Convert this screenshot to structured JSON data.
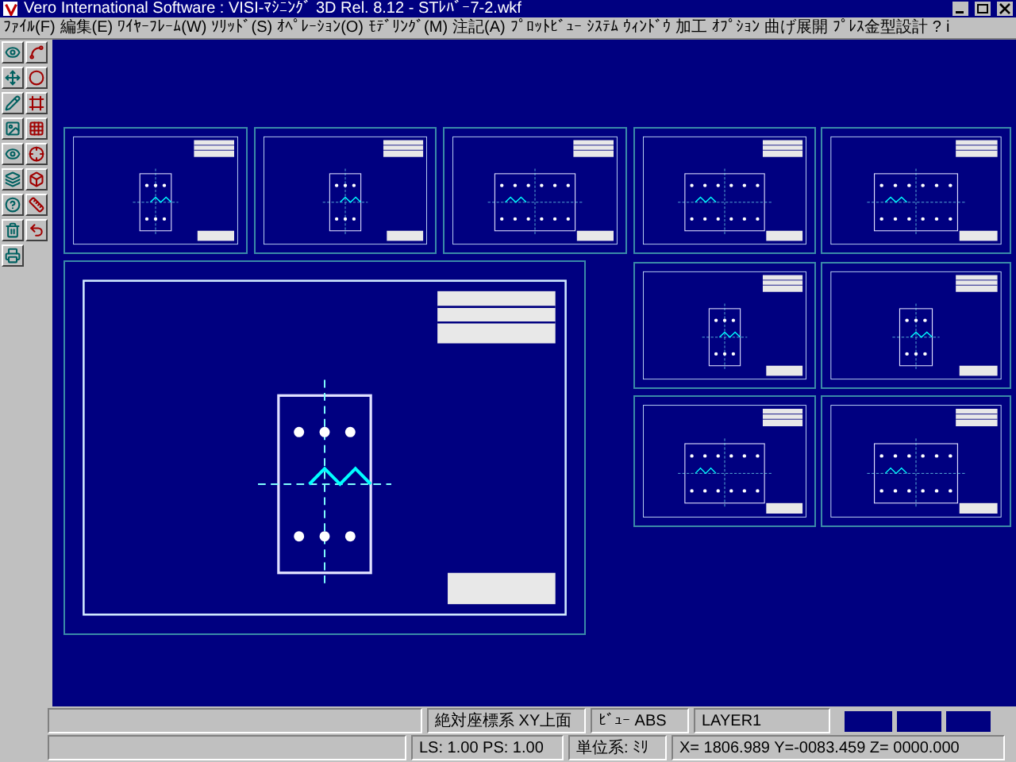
{
  "window": {
    "title": "Vero International Software : VISI-ﾏｼﾆﾝｸﾞ 3D Rel. 8.12 - STﾚﾊﾞｰ7-2.wkf"
  },
  "menu": [
    "ﾌｧｲﾙ(F)",
    "編集(E)",
    "ﾜｲﾔｰﾌﾚｰﾑ(W)",
    "ｿﾘｯﾄﾞ(S)",
    "ｵﾍﾟﾚｰｼｮﾝ(O)",
    "ﾓﾃﾞﾘﾝｸﾞ(M)",
    "注記(A)",
    "ﾌﾟﾛｯﾄﾋﾞｭｰ",
    "ｼｽﾃﾑ",
    "ｳｨﾝﾄﾞｳ",
    "加工",
    "ｵﾌﾟｼｮﾝ",
    "曲げ展開",
    "ﾌﾟﾚｽ金型設計",
    "?",
    "i"
  ],
  "status_bar": {
    "coordinate_system": "絶対座標系  XY上面",
    "view": "ﾋﾞｭｰ ABS",
    "layer": "LAYER1",
    "scale": "LS: 1.00 PS: 1.00",
    "units": "単位系: ﾐﾘ",
    "coordinates": "X= 1806.989 Y=-0083.459 Z= 0000.000"
  }
}
